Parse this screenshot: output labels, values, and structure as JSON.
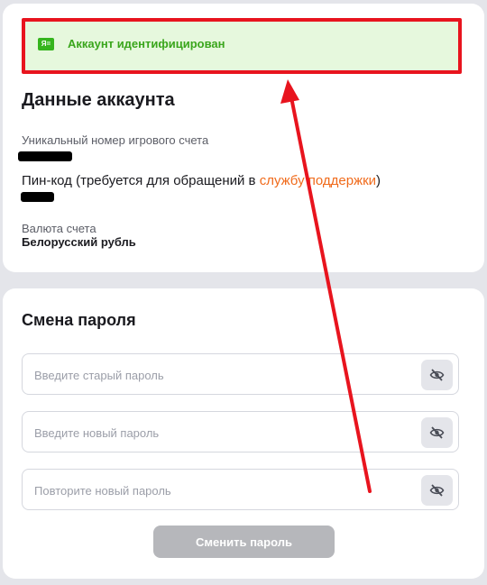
{
  "banner": {
    "icon": "id-card-icon",
    "icon_text": "Я=",
    "text": "Аккаунт идентифицирован",
    "color": "#3aa61c",
    "background": "#e6f8dd",
    "highlight_border": "#e8141e"
  },
  "account": {
    "title": "Данные аккаунта",
    "account_number_label": "Уникальный номер игрового счета",
    "pin_label_prefix": "Пин-код (требуется для обращений в ",
    "pin_link": "службу поддержки",
    "pin_label_suffix": ")",
    "currency_label": "Валюта счета",
    "currency_value": "Белорусский рубль"
  },
  "password": {
    "title": "Смена пароля",
    "old_placeholder": "Введите старый пароль",
    "new_placeholder": "Введите новый пароль",
    "repeat_placeholder": "Повторите новый пароль",
    "eye_icon": "eye-off-icon",
    "submit_label": "Сменить пароль"
  },
  "colors": {
    "link": "#f06a1a",
    "annotation_arrow": "#e8141e",
    "button_disabled": "#b6b7bb"
  }
}
